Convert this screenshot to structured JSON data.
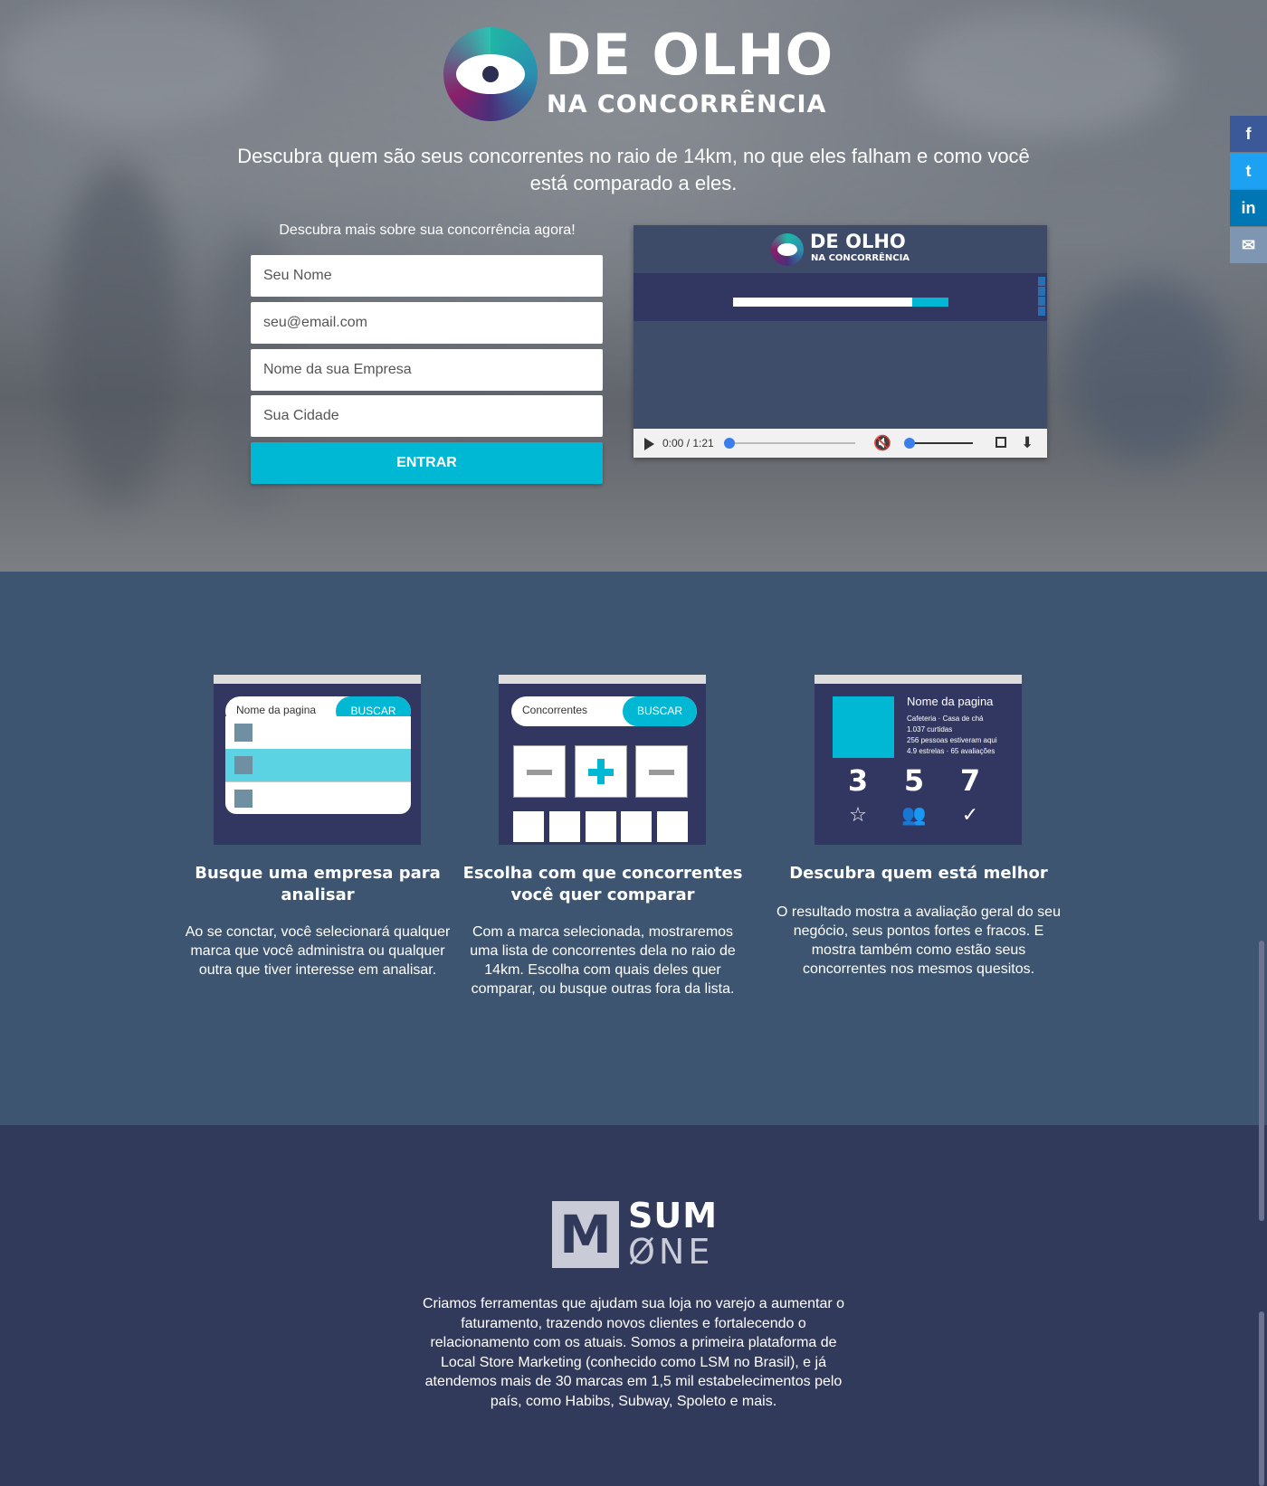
{
  "logo": {
    "line1": "DE OLHO",
    "line2": "NA CONCORRÊNCIA"
  },
  "hero": {
    "tagline": "Descubra quem são seus concorrentes no raio de 14km, no que eles falham e como você está comparado a eles.",
    "form_title": "Descubra mais sobre sua concorrência agora!",
    "fields": {
      "name_placeholder": "Seu Nome",
      "email_placeholder": "seu@email.com",
      "company_placeholder": "Nome da sua Empresa",
      "city_placeholder": "Sua Cidade"
    },
    "submit_label": "ENTRAR",
    "accent_color": "#00b8d4"
  },
  "video": {
    "logo_line1": "DE OLHO",
    "logo_line2": "NA CONCORRÊNCIA",
    "time": "0:00 / 1:21",
    "progress": 0,
    "volume": 0.1,
    "icons": [
      "play-icon",
      "mute-icon",
      "fullscreen-icon",
      "download-icon"
    ]
  },
  "share": [
    {
      "label": "f",
      "icon": "facebook-icon",
      "color": "#3b5998"
    },
    {
      "label": "t",
      "icon": "twitter-icon",
      "color": "#1da1f2"
    },
    {
      "label": "in",
      "icon": "linkedin-icon",
      "color": "#0077b5"
    },
    {
      "label": "✉",
      "icon": "email-icon",
      "color": "#7f96b3"
    }
  ],
  "features": [
    {
      "title": "Busque uma empresa para analisar",
      "description": "Ao se conctar, você selecionará qualquer marca que você administra ou qualquer outra que tiver interesse em analisar.",
      "card": {
        "input_text": "Nome da pagina",
        "button": "BUSCAR"
      }
    },
    {
      "title": "Escolha com que concorrentes você quer comparar",
      "description": "Com a marca selecionada, mostraremos uma lista de concorrentes dela no raio de 14km. Escolha com quais deles quer comparar, ou busque outras fora da lista.",
      "card": {
        "input_text": "Concorrentes",
        "button": "BUSCAR"
      }
    },
    {
      "title": "Descubra quem está melhor",
      "description": "O resultado mostra a avaliação geral do seu negócio, seus pontos fortes e fracos. E mostra também como estão seus concorrentes nos mesmos quesitos.",
      "card": {
        "page_name": "Nome da pagina",
        "lines": [
          "Cafeteria · Casa de chá",
          "1.037 curtidas",
          "256 pessoas estiveram aqui",
          "4.9 estrelas · 65 avaliações"
        ],
        "stats": [
          "3",
          "5",
          "7"
        ]
      }
    }
  ],
  "footer": {
    "brand_line1": "SUM",
    "brand_line2": "ØNE",
    "about": "Criamos ferramentas que ajudam sua loja no varejo a aumentar o faturamento, trazendo novos clientes e fortalecendo o relacionamento com os atuais. Somos a primeira plataforma de Local Store Marketing (conhecido como LSM no Brasil), e já atendemos mais de 30 marcas em 1,5 mil estabelecimentos pelo país, como Habibs, Subway, Spoleto e mais."
  }
}
